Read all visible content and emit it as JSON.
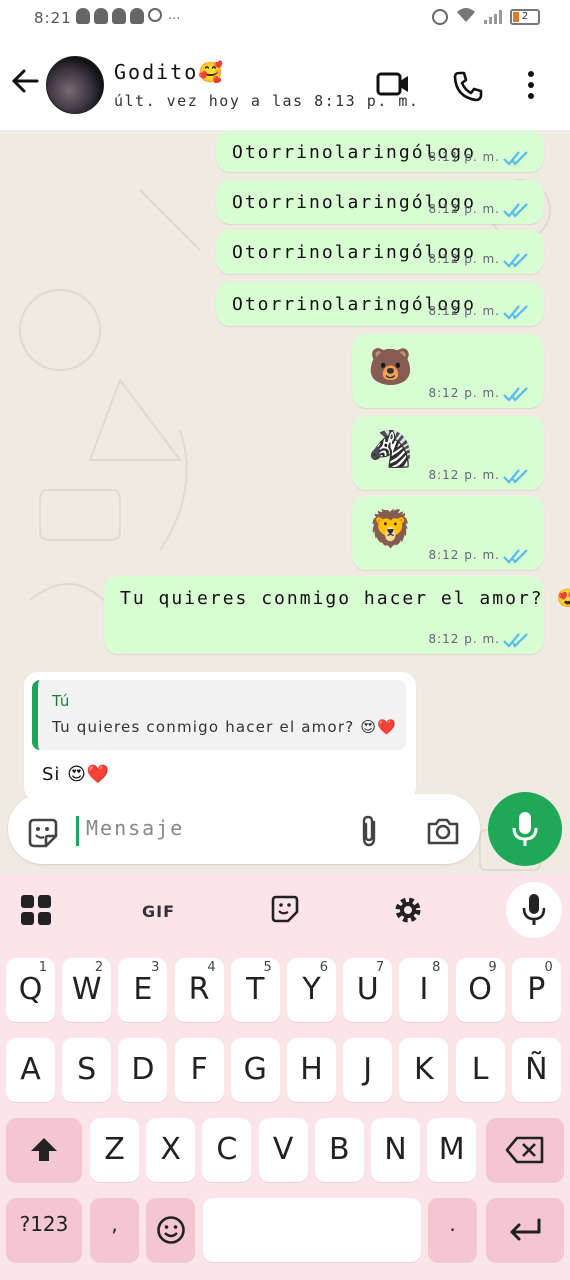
{
  "status_bar": {
    "time": "8:21",
    "battery": "2",
    "extra_icon": "..."
  },
  "header": {
    "contact_name": "Godito🥰",
    "last_seen": "últ. vez hoy a las 8:13 p. m."
  },
  "messages_out": [
    {
      "text": "Otorrinolaringólogo",
      "time": "8:11 p. m."
    },
    {
      "text": "Otorrinolaringólogo",
      "time": "8:12 p. m."
    },
    {
      "text": "Otorrinolaringólogo",
      "time": "8:12 p. m."
    },
    {
      "text": "Otorrinolaringólogo",
      "time": "8:12 p. m."
    },
    {
      "text": "🐻",
      "time": "8:12 p. m."
    },
    {
      "text": "🦓",
      "time": "8:12 p. m."
    },
    {
      "text": "🦁",
      "time": "8:12 p. m."
    },
    {
      "text": "Tu quieres conmigo hacer el amor? 😍❤️",
      "time": "8:12 p. m."
    }
  ],
  "incoming": {
    "quote_author": "Tú",
    "quote_text": "Tu quieres conmigo hacer el amor? 😍❤️",
    "reply_text": "Si 😍❤️"
  },
  "composer": {
    "placeholder": "Mensaje"
  },
  "keyboard": {
    "gif_label": "GIF",
    "row1": [
      {
        "k": "Q",
        "n": "1"
      },
      {
        "k": "W",
        "n": "2"
      },
      {
        "k": "E",
        "n": "3"
      },
      {
        "k": "R",
        "n": "4"
      },
      {
        "k": "T",
        "n": "5"
      },
      {
        "k": "Y",
        "n": "6"
      },
      {
        "k": "U",
        "n": "7"
      },
      {
        "k": "I",
        "n": "8"
      },
      {
        "k": "O",
        "n": "9"
      },
      {
        "k": "P",
        "n": "0"
      }
    ],
    "row2": [
      "A",
      "S",
      "D",
      "F",
      "G",
      "H",
      "J",
      "K",
      "L",
      "Ñ"
    ],
    "row3": [
      "Z",
      "X",
      "C",
      "V",
      "B",
      "N",
      "M"
    ],
    "sym_label": "?123",
    "comma": ",",
    "period": ".",
    "colors": {
      "bubble_out": "#d9fdd3",
      "accent": "#1fa855",
      "ticks": "#53bdeb",
      "keyboard_bg": "#fbe4ea",
      "func_key": "#f3c6d2"
    }
  }
}
